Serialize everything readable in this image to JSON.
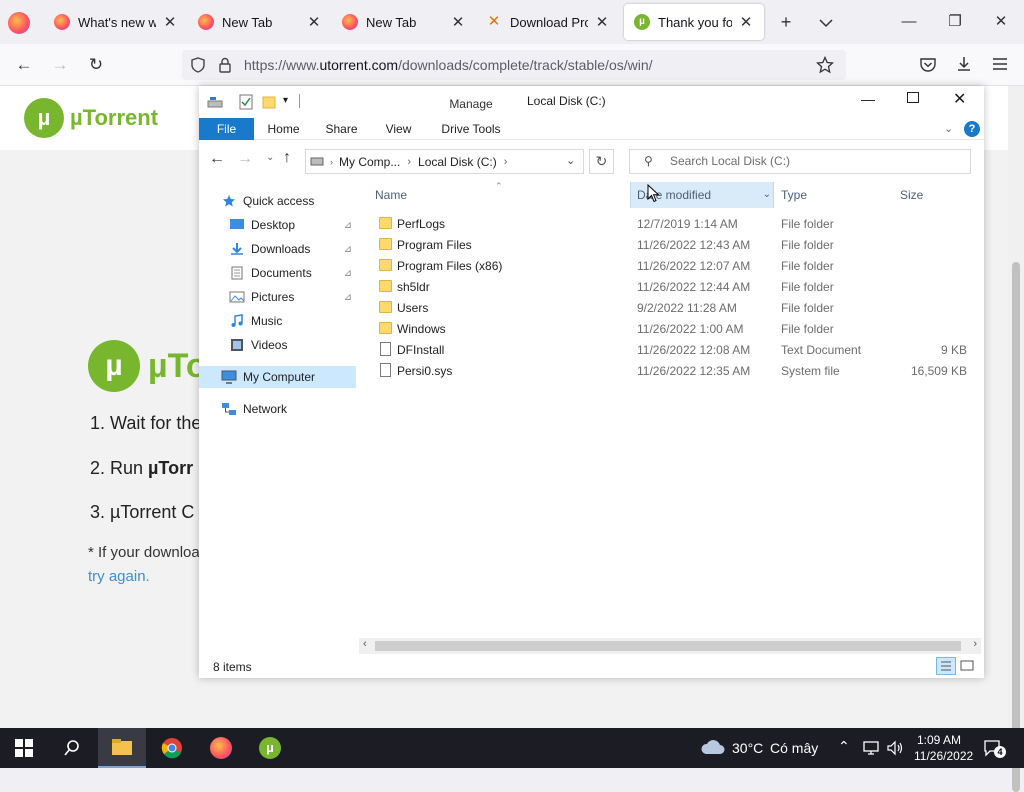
{
  "browser": {
    "tabs": [
      {
        "title": "What's new with",
        "icon": "firefox-icon"
      },
      {
        "title": "New Tab",
        "icon": "firefox-icon"
      },
      {
        "title": "New Tab",
        "icon": "firefox-icon"
      },
      {
        "title": "Download Prox",
        "icon": "proxy-icon"
      },
      {
        "title": "Thank you for D",
        "icon": "utorrent-icon",
        "active": true
      }
    ],
    "url_prefix": "https://www.",
    "url_domain": "utorrent.com",
    "url_path": "/downloads/complete/track/stable/os/win/"
  },
  "webpage": {
    "logo_text": "µTorrent",
    "logo_text_big": "µTo",
    "steps": [
      "1. Wait for the",
      "2. Run µTorr",
      "3. µTorrent C"
    ],
    "step2_prefix": "2. Run ",
    "step2_bold": "µTorr",
    "note": "* If your downloa",
    "retry_link": "try again."
  },
  "explorer": {
    "title": "Local Disk (C:)",
    "manage_label": "Manage",
    "ribbon_tabs": [
      "File",
      "Home",
      "Share",
      "View",
      "Drive Tools"
    ],
    "breadcrumb": [
      "My Comp...",
      "Local Disk (C:)"
    ],
    "search_placeholder": "Search Local Disk (C:)",
    "nav": [
      {
        "label": "Quick access",
        "icon": "star-icon",
        "pinned": false
      },
      {
        "label": "Desktop",
        "icon": "desktop-icon",
        "pinned": true
      },
      {
        "label": "Downloads",
        "icon": "download-icon",
        "pinned": true
      },
      {
        "label": "Documents",
        "icon": "documents-icon",
        "pinned": true
      },
      {
        "label": "Pictures",
        "icon": "pictures-icon",
        "pinned": true
      },
      {
        "label": "Music",
        "icon": "music-icon",
        "pinned": false
      },
      {
        "label": "Videos",
        "icon": "videos-icon",
        "pinned": false
      },
      {
        "label": "My Computer",
        "icon": "computer-icon",
        "pinned": false,
        "selected": true
      },
      {
        "label": "Network",
        "icon": "network-icon",
        "pinned": false
      }
    ],
    "columns": [
      "Name",
      "Date modified",
      "Type",
      "Size"
    ],
    "files": [
      {
        "name": "PerfLogs",
        "date": "12/7/2019 1:14 AM",
        "type": "File folder",
        "size": "",
        "kind": "folder"
      },
      {
        "name": "Program Files",
        "date": "11/26/2022 12:43 AM",
        "type": "File folder",
        "size": "",
        "kind": "folder"
      },
      {
        "name": "Program Files (x86)",
        "date": "11/26/2022 12:07 AM",
        "type": "File folder",
        "size": "",
        "kind": "folder"
      },
      {
        "name": "sh5ldr",
        "date": "11/26/2022 12:44 AM",
        "type": "File folder",
        "size": "",
        "kind": "folder"
      },
      {
        "name": "Users",
        "date": "9/2/2022 11:28 AM",
        "type": "File folder",
        "size": "",
        "kind": "folder"
      },
      {
        "name": "Windows",
        "date": "11/26/2022 1:00 AM",
        "type": "File folder",
        "size": "",
        "kind": "folder"
      },
      {
        "name": "DFInstall",
        "date": "11/26/2022 12:08 AM",
        "type": "Text Document",
        "size": "9 KB",
        "kind": "doc"
      },
      {
        "name": "Persi0.sys",
        "date": "11/26/2022 12:35 AM",
        "type": "System file",
        "size": "16,509 KB",
        "kind": "sys"
      }
    ],
    "status": "8 items"
  },
  "taskbar": {
    "weather_temp": "30°C",
    "weather_desc": "Có mây",
    "time": "1:09 AM",
    "date": "11/26/2022",
    "notifications": "4"
  },
  "colors": {
    "accent": "#1979ca",
    "utorrent_green": "#78b72d",
    "manage_green": "#c7e9a8",
    "selected": "#cce8ff"
  }
}
